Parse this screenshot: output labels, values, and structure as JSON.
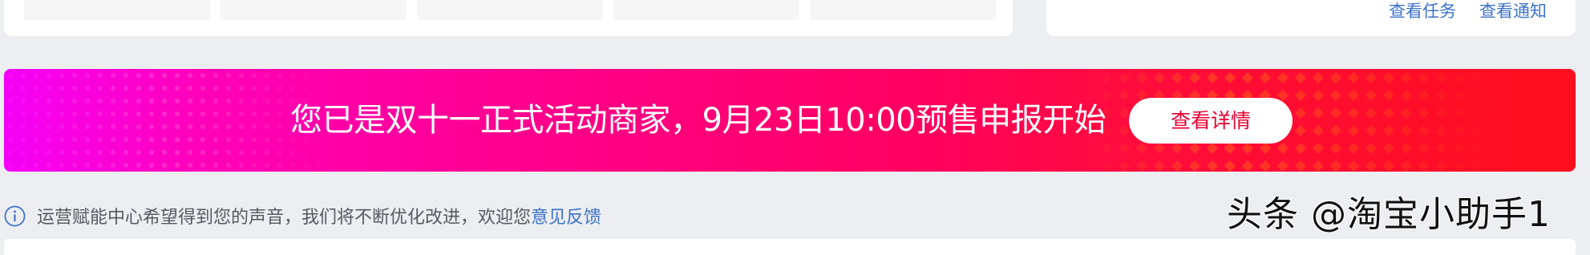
{
  "top_card": {
    "links": [
      "查看任务",
      "查看通知"
    ]
  },
  "banner": {
    "text": "您已是双十一正式活动商家，9月23日10:00预售申报开始",
    "button_label": "查看详情",
    "colors": {
      "gradient_start": "#f500f8",
      "gradient_end": "#ff0e1e",
      "button_text": "#e8002f"
    }
  },
  "notice": {
    "icon": "info-icon",
    "text": "运营赋能中心希望得到您的声音，我们将不断优化改进，欢迎您",
    "link_label": "意见反馈"
  },
  "watermark": {
    "text": "头条 @淘宝小助手1"
  },
  "theme": {
    "link_color": "#3d72c9",
    "page_background": "#eceef1"
  }
}
